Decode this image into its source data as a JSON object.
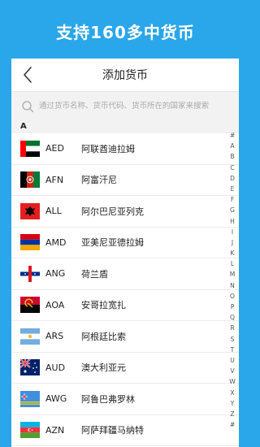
{
  "banner": {
    "title": "支持160多中货币"
  },
  "navbar": {
    "title": "添加货币"
  },
  "search": {
    "placeholder": "通过货币名称、货币代码、货币所在的国家来搜索"
  },
  "section": {
    "letter": "A"
  },
  "currencies": [
    {
      "code": "AED",
      "name": "阿联酋迪拉姆",
      "flag": "uae-flag-icon"
    },
    {
      "code": "AFN",
      "name": "阿富汗尼",
      "flag": "afghanistan-flag-icon"
    },
    {
      "code": "ALL",
      "name": "阿尔巴尼亚列克",
      "flag": "albania-flag-icon"
    },
    {
      "code": "AMD",
      "name": "亚美尼亚德拉姆",
      "flag": "armenia-flag-icon"
    },
    {
      "code": "ANG",
      "name": "荷兰盾",
      "flag": "netherlands-antilles-flag-icon"
    },
    {
      "code": "AOA",
      "name": "安哥拉宽扎",
      "flag": "angola-flag-icon"
    },
    {
      "code": "ARS",
      "name": "阿根廷比索",
      "flag": "argentina-flag-icon"
    },
    {
      "code": "AUD",
      "name": "澳大利亚元",
      "flag": "australia-flag-icon"
    },
    {
      "code": "AWG",
      "name": "阿鲁巴弗罗林",
      "flag": "aruba-flag-icon"
    },
    {
      "code": "AZN",
      "name": "阿萨拜疆马纳特",
      "flag": "azerbaijan-flag-icon"
    }
  ],
  "index_letters": [
    "#",
    "A",
    "B",
    "C",
    "D",
    "E",
    "F",
    "G",
    "H",
    "I",
    "J",
    "K",
    "L",
    "M",
    "N",
    "O",
    "P",
    "Q",
    "R",
    "S",
    "T",
    "U",
    "V",
    "W",
    "X",
    "Y",
    "Z",
    "#"
  ],
  "colors": {
    "background": "#2aa6ea",
    "card": "#ffffff",
    "section": "#f2f2f2"
  }
}
